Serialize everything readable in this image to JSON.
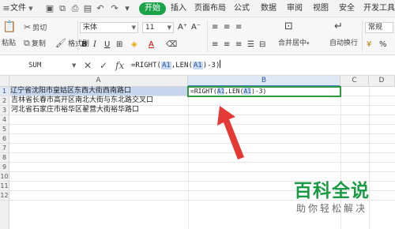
{
  "menubar": {
    "file_label": "文件",
    "tabs": [
      "开始",
      "插入",
      "页面布局",
      "公式",
      "数据",
      "审阅",
      "视图",
      "安全",
      "开发工具"
    ]
  },
  "ribbon": {
    "cut_label": "剪切",
    "paste_label": "粘贴",
    "copy_label": "复制",
    "format_painter_label": "格式刷",
    "font_name": "宋体",
    "font_size": "11",
    "merge_center_label": "合并居中",
    "wrap_text_label": "自动换行",
    "number_format": "常规"
  },
  "formula_bar": {
    "name_box": "SUM",
    "formula_prefix": "=RIGHT(",
    "ref1": "A1",
    "formula_mid": ",LEN(",
    "ref2": "A1",
    "formula_suffix": ")-3)"
  },
  "grid": {
    "columns": [
      "A",
      "B",
      "C",
      "D"
    ],
    "rows": [
      "1",
      "2",
      "3",
      "4",
      "5",
      "6",
      "7",
      "8",
      "9",
      "10",
      "11",
      "12"
    ],
    "cells": {
      "A1": "辽宁省沈阳市皇姑区东西大街西南路口",
      "A2": "吉林省长春市高开区南北大街与东北路交叉口",
      "A3": "河北省石家庄市裕华区翟营大街裕华路口",
      "B1_prefix": "=RIGHT(",
      "B1_ref1": "A1",
      "B1_mid": ",LEN(",
      "B1_ref2": "A1",
      "B1_suffix": ")-3)"
    }
  },
  "watermark": {
    "main": "百科全说",
    "sub": "助你轻松解决"
  },
  "colors": {
    "accent_green": "#1ba34a",
    "arrow_red": "#e53935",
    "selection_blue": "#c6d6ee",
    "active_cell_border": "#2e9b3f"
  }
}
